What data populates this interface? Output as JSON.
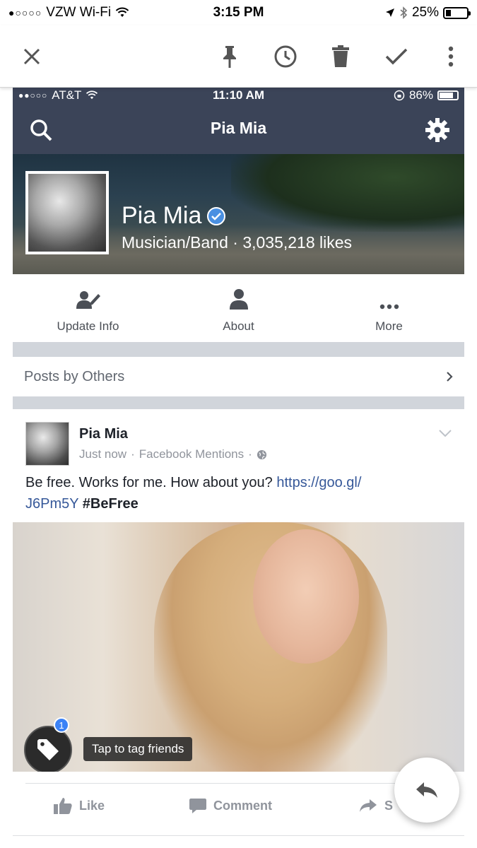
{
  "device_status": {
    "carrier": "VZW Wi-Fi",
    "time": "3:15 PM",
    "battery": "25%",
    "battery_level": 0.25
  },
  "toolbar": {
    "icons": [
      "close-icon",
      "pin-icon",
      "clock-icon",
      "trash-icon",
      "check-icon",
      "more-vert-icon"
    ]
  },
  "fb_status": {
    "carrier": "AT&T",
    "time": "11:10 AM",
    "battery": "86%",
    "battery_level": 0.86
  },
  "fb_nav": {
    "title": "Pia Mia",
    "left_icon": "search-icon",
    "right_icon": "gear-icon"
  },
  "profile": {
    "name": "Pia Mia",
    "category": "Musician/Band",
    "likes": "3,035,218 likes",
    "separator": " · "
  },
  "actions": [
    {
      "label": "Update Info",
      "icon": "edit-user-icon"
    },
    {
      "label": "About",
      "icon": "person-icon"
    },
    {
      "label": "More",
      "icon": "more-horiz-icon"
    }
  ],
  "posts_by_others": {
    "label": "Posts by Others"
  },
  "post": {
    "author": "Pia Mia",
    "time": "Just now",
    "source": "Facebook Mentions",
    "dot": "·",
    "text": "Be free. Works for me. How about you? ",
    "link": "https://goo.gl/J6Pm5Y",
    "link_line1": "https://goo.gl/",
    "link_line2": "J6Pm5Y",
    "hashtag": "#BeFree",
    "tag_count": "1",
    "tag_tip": "Tap to tag friends"
  },
  "reactions": {
    "like": "Like",
    "comment": "Comment",
    "share": "S"
  },
  "colors": {
    "fb_nav_bg": "#3b4458",
    "link": "#365899",
    "verified": "#4a90e2",
    "divider_gray": "#d1d5db"
  }
}
